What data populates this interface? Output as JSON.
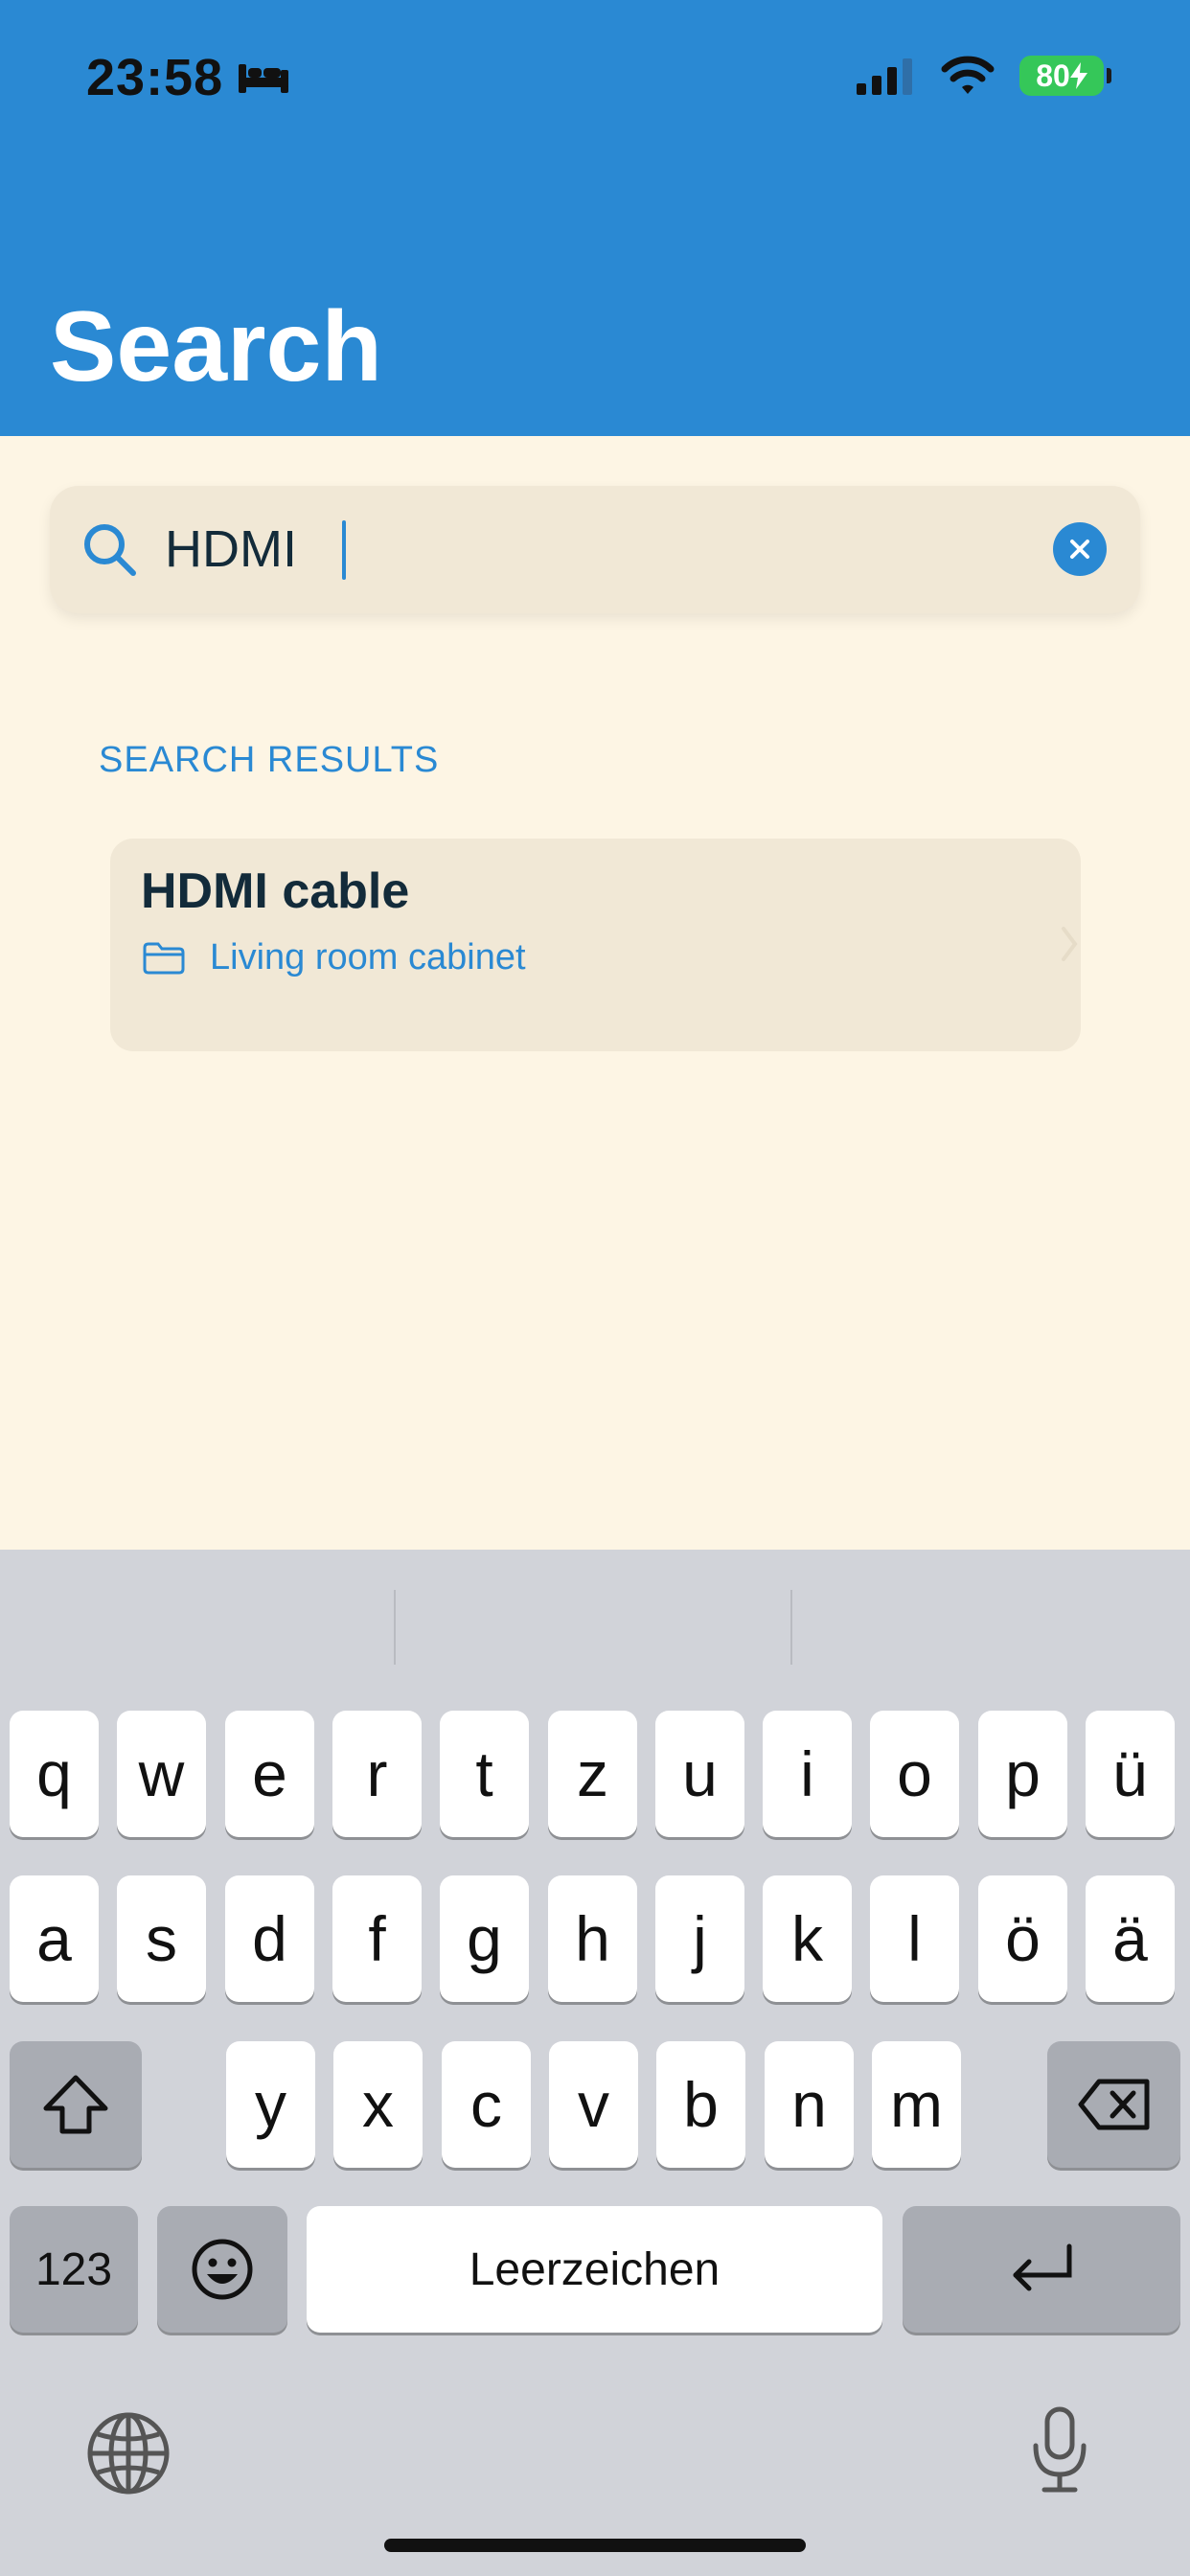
{
  "status_bar": {
    "time": "23:58",
    "battery": "80"
  },
  "header": {
    "title": "Search"
  },
  "search": {
    "value": "HDMI",
    "placeholder": ""
  },
  "results": {
    "section_label": "SEARCH RESULTS",
    "items": [
      {
        "title": "HDMI cable",
        "location": "Living room cabinet"
      }
    ]
  },
  "keyboard": {
    "row1": [
      "q",
      "w",
      "e",
      "r",
      "t",
      "z",
      "u",
      "i",
      "o",
      "p",
      "ü"
    ],
    "row2": [
      "a",
      "s",
      "d",
      "f",
      "g",
      "h",
      "j",
      "k",
      "l",
      "ö",
      "ä"
    ],
    "row3": [
      "y",
      "x",
      "c",
      "v",
      "b",
      "n",
      "m"
    ],
    "numbers_label": "123",
    "space_label": "Leerzeichen"
  },
  "colors": {
    "accent": "#2A89D3",
    "background": "#FDF5E4",
    "card": "#F1E8D6",
    "keyboard": "#D1D3D9"
  }
}
